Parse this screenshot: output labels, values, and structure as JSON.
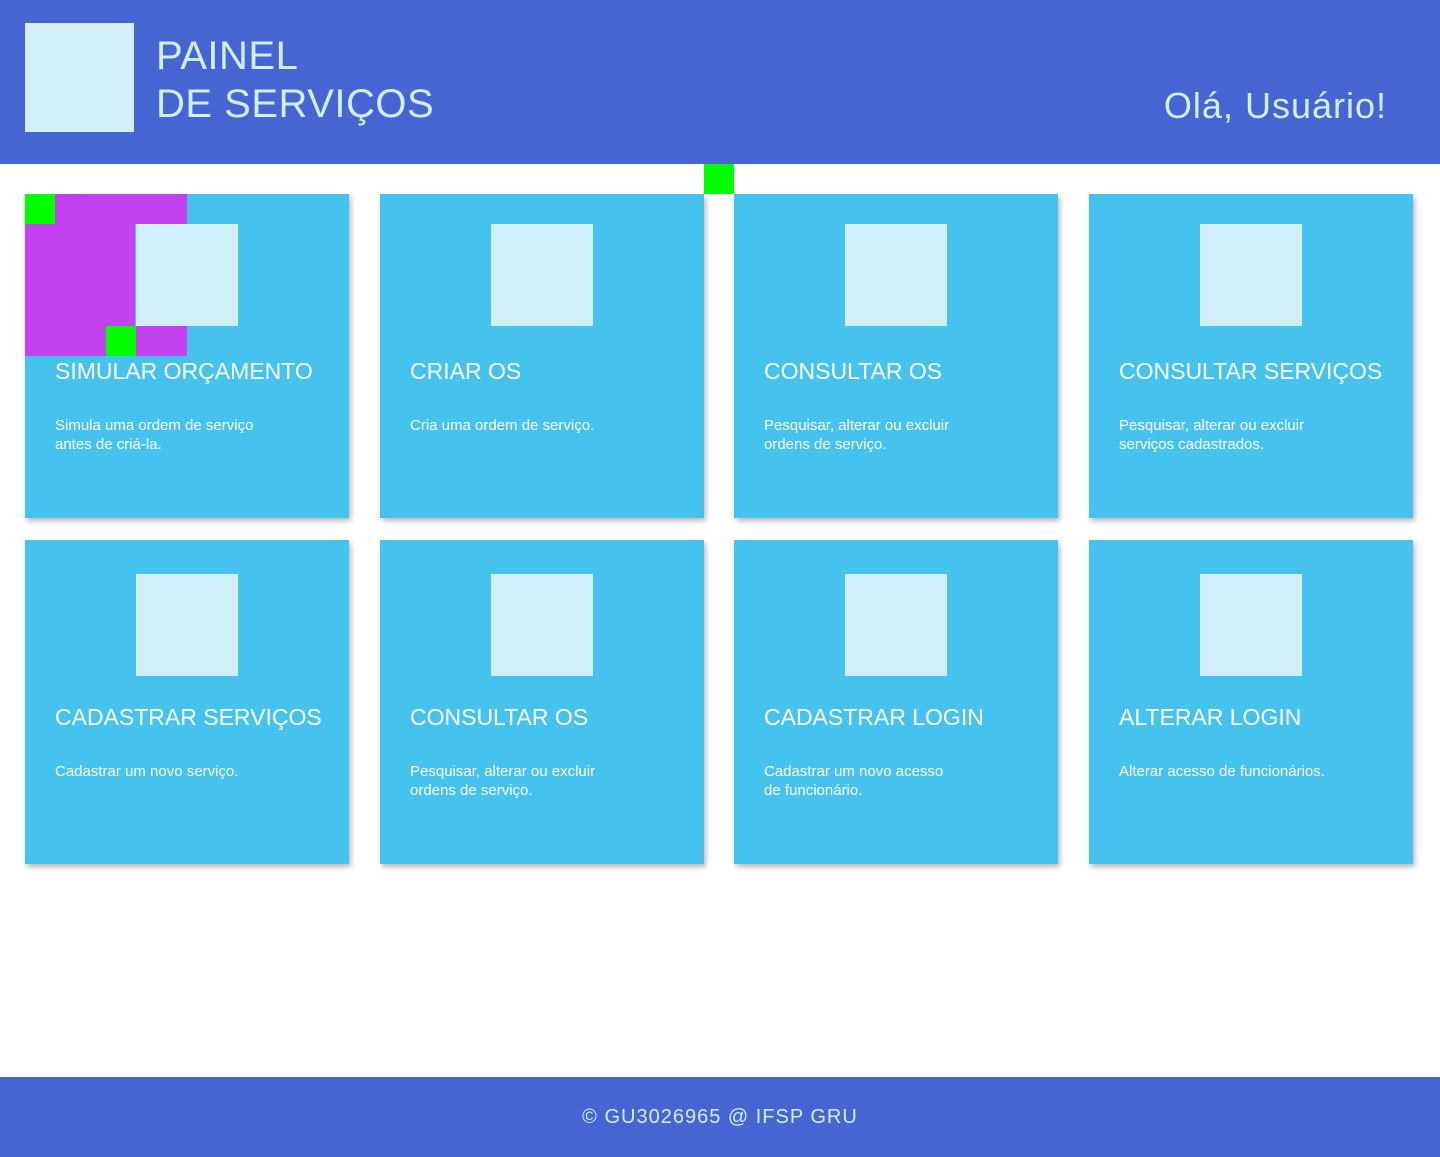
{
  "header": {
    "title_line1": "PAINEL",
    "title_line2": "DE SERVIÇOS",
    "greeting": "Olá, Usuário!"
  },
  "cards": [
    {
      "title": "SIMULAR ORÇAMENTO",
      "description": "Simula uma ordem de serviço\nantes de criá-la."
    },
    {
      "title": "CRIAR OS",
      "description": "Cria uma ordem de serviço."
    },
    {
      "title": "CONSULTAR OS",
      "description": "Pesquisar, alterar ou excluir\nordens de serviço."
    },
    {
      "title": "CONSULTAR SERVIÇOS",
      "description": "Pesquisar, alterar ou excluir\nserviços cadastrados."
    },
    {
      "title": "CADASTRAR SERVIÇOS",
      "description": "Cadastrar um novo serviço."
    },
    {
      "title": "CONSULTAR OS",
      "description": "Pesquisar, alterar ou excluir\nordens de serviço."
    },
    {
      "title": "CADASTRAR LOGIN",
      "description": "Cadastrar um novo acesso\nde funcionário."
    },
    {
      "title": "ALTERAR LOGIN",
      "description": "Alterar acesso de funcionários."
    }
  ],
  "footer": {
    "text": "© GU3026965 @ IFSP GRU"
  },
  "colors": {
    "header_bg": "#4565d3",
    "card_bg": "#45c3ee",
    "icon_placeholder": "#d1eff9",
    "marker_green": "#00ff00",
    "marker_purple": "#c142ee"
  }
}
